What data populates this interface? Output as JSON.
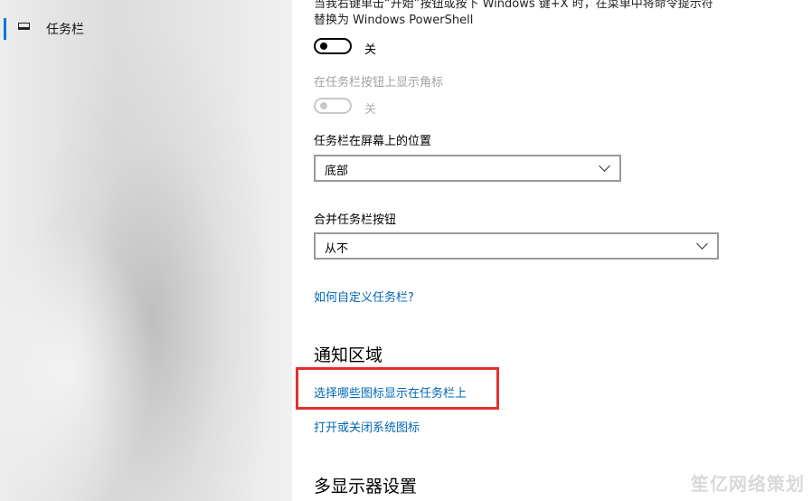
{
  "sidebar": {
    "items": [
      {
        "label": "任务栏",
        "icon": "taskbar-icon",
        "selected": true
      }
    ],
    "accent": "#0078d7"
  },
  "settings": {
    "powershell_desc": "当我右键单击“开始”按钮或按下 Windows 键+X 时，在菜单中将命令提示符替换为 Windows PowerShell",
    "powershell_toggle_state": "关",
    "badges_label": "在任务栏按钮上显示角标",
    "badges_toggle_state": "关",
    "position_label": "任务栏在屏幕上的位置",
    "position_value": "底部",
    "combine_label": "合并任务栏按钮",
    "combine_value": "从不",
    "customize_link": "如何自定义任务栏?"
  },
  "notification": {
    "title": "通知区域",
    "select_icons_link": "选择哪些图标显示在任务栏上",
    "system_icons_link": "打开或关闭系统图标"
  },
  "multi_display": {
    "title": "多显示器设置"
  },
  "watermark": "笙亿网络策划",
  "colors": {
    "link": "#0067b8",
    "highlight_box": "#e53030"
  }
}
